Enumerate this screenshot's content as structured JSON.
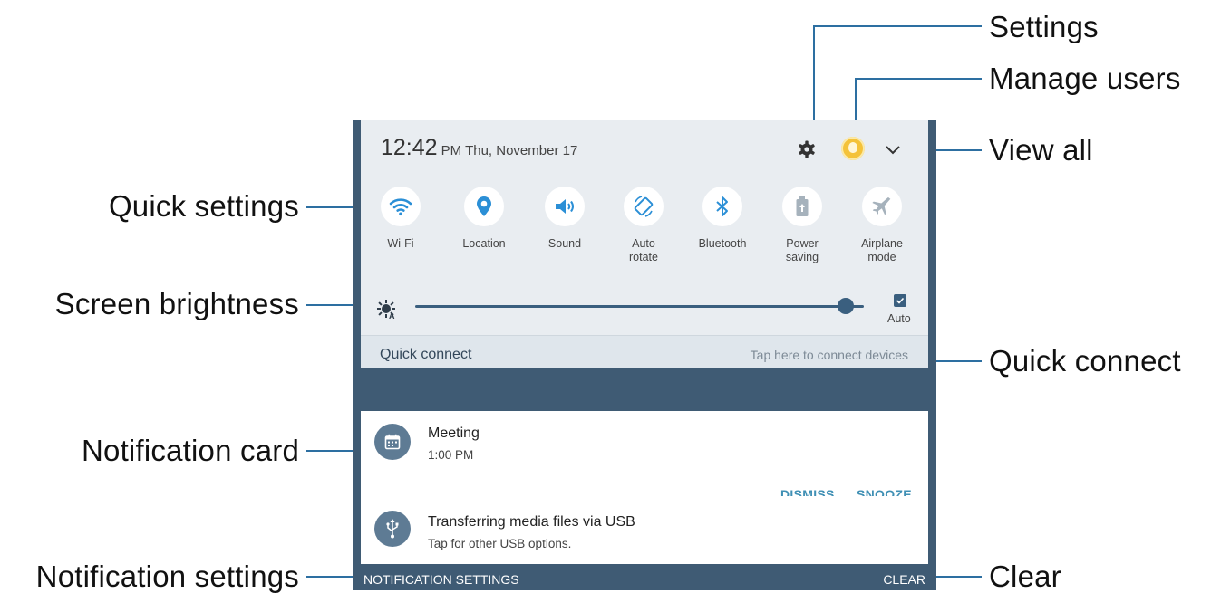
{
  "colors": {
    "accent": "#3f8fb4",
    "leader": "#2d6fa1",
    "panel_bg": "#e9edf1",
    "icon_blue": "#2b8fd6",
    "shade": "#3f5b74"
  },
  "callouts": {
    "settings": "Settings",
    "manage_users": "Manage users",
    "view_all": "View all",
    "quick_settings": "Quick settings",
    "screen_brightness": "Screen brightness",
    "quick_connect": "Quick connect",
    "notification_card": "Notification card",
    "notification_settings": "Notification settings",
    "clear": "Clear"
  },
  "status": {
    "time": "12:42",
    "ampm": "PM",
    "date": "Thu, November 17"
  },
  "header_icons": [
    "gear-icon",
    "avatar",
    "chevron-down-icon"
  ],
  "quick_settings": {
    "tiles": [
      {
        "label": "Wi-Fi",
        "icon": "wifi-icon"
      },
      {
        "label": "Location",
        "icon": "location-pin-icon"
      },
      {
        "label": "Sound",
        "icon": "speaker-icon"
      },
      {
        "label": "Auto\nrotate",
        "icon": "auto-rotate-icon"
      },
      {
        "label": "Bluetooth",
        "icon": "bluetooth-icon"
      },
      {
        "label": "Power\nsaving",
        "icon": "battery-icon"
      },
      {
        "label": "Airplane\nmode",
        "icon": "airplane-icon"
      }
    ]
  },
  "brightness": {
    "level": 0.96,
    "auto_label": "Auto",
    "auto_checked": true
  },
  "quick_connect": {
    "title": "Quick connect",
    "hint": "Tap here to connect devices"
  },
  "notifications": [
    {
      "title": "Meeting",
      "subtitle": "1:00 PM",
      "icon": "calendar-icon",
      "actions": [
        "DISMISS",
        "SNOOZE"
      ]
    },
    {
      "title": "Transferring media files via USB",
      "subtitle": "Tap for other USB options.",
      "icon": "usb-icon"
    }
  ],
  "footer": {
    "notification_settings": "NOTIFICATION SETTINGS",
    "clear": "CLEAR"
  }
}
